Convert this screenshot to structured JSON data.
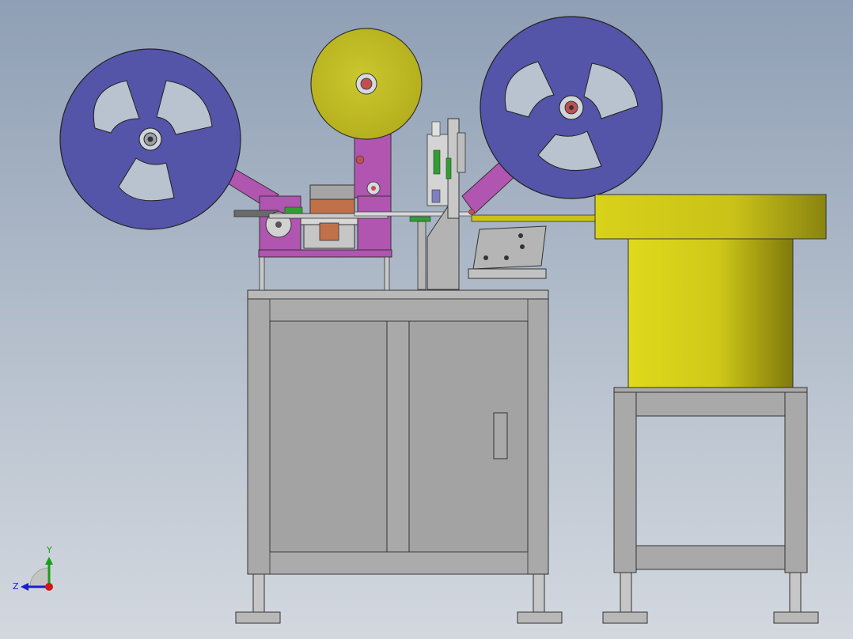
{
  "viewport": {
    "background_top": "#8f9fb5",
    "background_bottom": "#d3d8df"
  },
  "triad": {
    "y_label": "Y",
    "z_label": "Z",
    "y_color": "#16a016",
    "z_color": "#1c1cd0",
    "x_color": "#d01818"
  },
  "colors": {
    "reel": "#5454a8",
    "tape_roll": "#c8c42a",
    "arm": "#b055b0",
    "cabinet": "#a9a9a9",
    "bowl": "#d8d21a"
  }
}
